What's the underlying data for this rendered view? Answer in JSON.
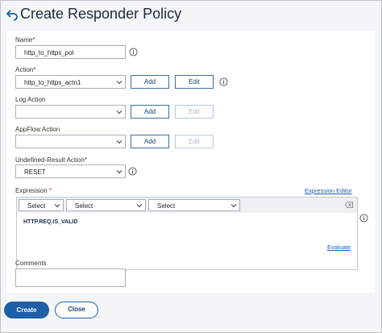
{
  "page": {
    "title": "Create Responder Policy"
  },
  "form": {
    "name_label": "Name*",
    "name_value": "http_to_https_pol",
    "action_label": "Action*",
    "action_value": "http_to_https_actn1",
    "log_action_label": "Log Action",
    "log_action_value": "",
    "appflow_action_label": "AppFlow Action",
    "appflow_action_value": "",
    "undefined_result_label": "Undefined-Result Action*",
    "undefined_result_value": "RESET",
    "add_label": "Add",
    "edit_label": "Edit",
    "expression_label": "Expression",
    "expression_required": "*",
    "expression_editor_link": "Expression Editor",
    "expression_selects": [
      "Select",
      "Select",
      "Select"
    ],
    "expression_value": "HTTP.REQ.IS_VALID",
    "evaluate_link": "Evaluate",
    "comments_label": "Comments",
    "comments_value": ""
  },
  "footer": {
    "create_label": "Create",
    "close_label": "Close"
  },
  "colors": {
    "primary": "#1f5fa8",
    "link": "#1a5fb4",
    "required": "#c0392b"
  },
  "icons": {
    "back": "back-arrow-icon",
    "info": "info-icon",
    "chevron": "chevron-down-icon",
    "clear": "clear-icon"
  }
}
